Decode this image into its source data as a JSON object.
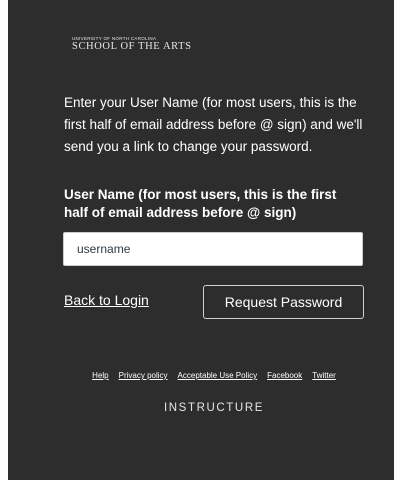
{
  "logo": {
    "top_line": "UNIVERSITY OF NORTH CAROLINA",
    "main_line": "SCHOOL OF THE ARTS"
  },
  "intro_text": "Enter your User Name (for most users, this is the first half of email address before @ sign) and we'll send you a link to change your password.",
  "form": {
    "label": "User Name (for most users, this is the first half of email address before @ sign)",
    "username_value": "username"
  },
  "actions": {
    "back_link": "Back to Login",
    "submit_label": "Request Password"
  },
  "footer": {
    "links": [
      "Help",
      "Privacy policy",
      "Acceptable Use Policy",
      "Facebook",
      "Twitter"
    ],
    "brand": "INSTRUCTURE"
  },
  "colors": {
    "panel_bg": "#2d2d2d",
    "text": "#ffffff",
    "input_bg": "#ffffff"
  }
}
